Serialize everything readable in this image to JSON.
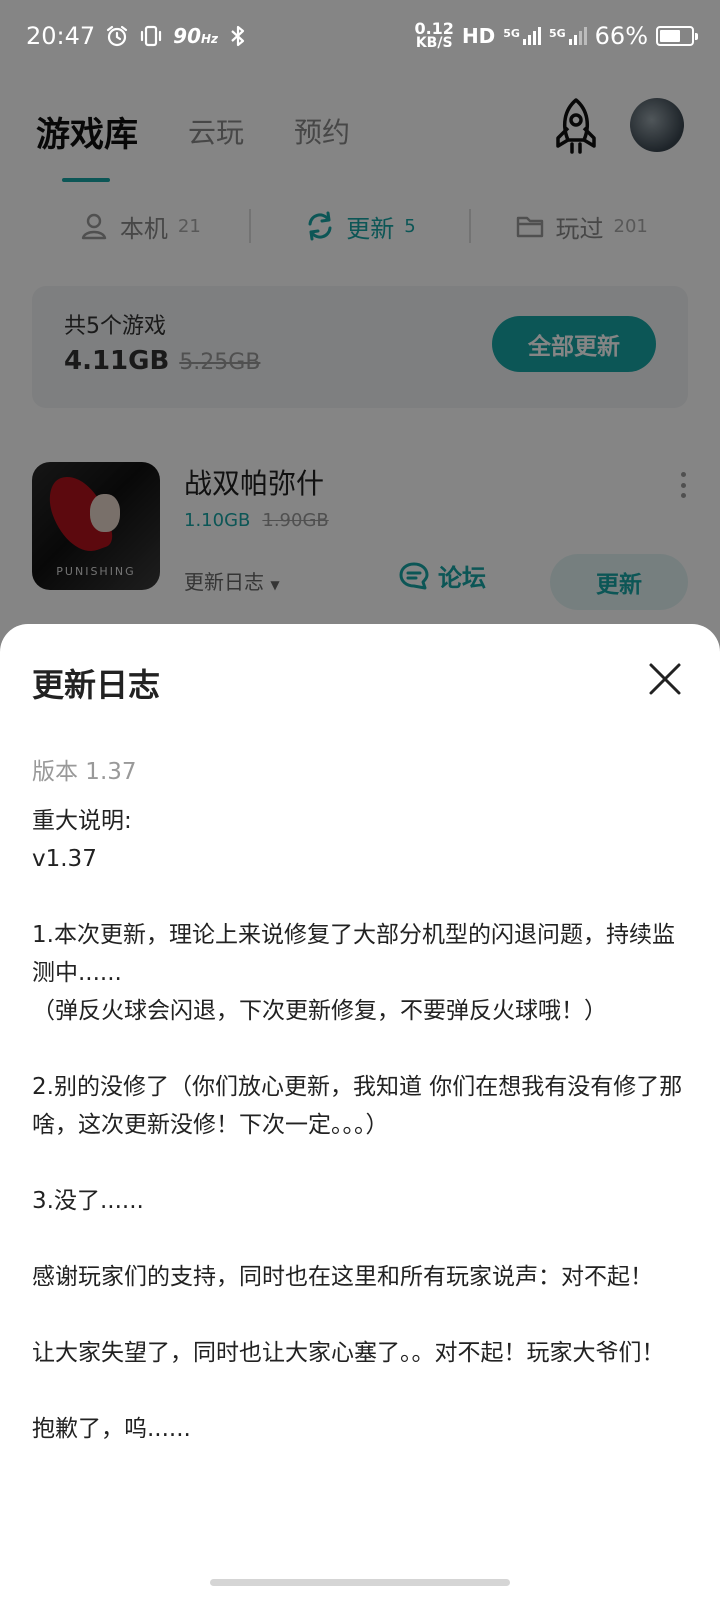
{
  "status_bar": {
    "time": "20:47",
    "refresh_rate": "90",
    "refresh_unit": "Hz",
    "net_speed_value": "0.12",
    "net_speed_unit": "KB/S",
    "hd_label": "HD",
    "network_1": "5G",
    "network_2": "5G",
    "battery": "66%",
    "battery_level": 0.66
  },
  "top_nav": {
    "tabs": [
      {
        "label": "游戏库",
        "active": true
      },
      {
        "label": "云玩",
        "active": false
      },
      {
        "label": "预约",
        "active": false
      }
    ]
  },
  "filters": [
    {
      "label": "本机",
      "count": "21",
      "icon": "phone-user-icon",
      "active": false
    },
    {
      "label": "更新",
      "count": "5",
      "icon": "refresh-icon",
      "active": true
    },
    {
      "label": "玩过",
      "count": "201",
      "icon": "folder-icon",
      "active": false
    }
  ],
  "summary": {
    "label": "共5个游戏",
    "size": "4.11GB",
    "original_size": "5.25GB",
    "update_all_label": "全部更新"
  },
  "game": {
    "title": "战双帕弥什",
    "size": "1.10GB",
    "original_size": "1.90GB",
    "changelog_label": "更新日志",
    "forum_label": "论坛",
    "update_label": "更新",
    "icon_text": "PUNISHING"
  },
  "sheet": {
    "title": "更新日志",
    "version": "版本 1.37",
    "lines": [
      "重大说明:",
      "v1.37",
      "",
      "1.本次更新，理论上来说修复了大部分机型的闪退问题，持续监测中......",
      "（弹反火球会闪退，下次更新修复，不要弹反火球哦！）",
      "",
      "2.别的没修了（你们放心更新，我知道 你们在想我有没有修了那啥，这次更新没修！下次一定。。。）",
      "",
      "3.没了......",
      "",
      "感谢玩家们的支持，同时也在这里和所有玩家说声：对不起！",
      "",
      "让大家失望了，同时也让大家心塞了。。对不起！玩家大爷们！",
      "",
      "抱歉了，呜......"
    ]
  },
  "colors": {
    "accent": "#17a5a5",
    "overlay": "rgba(0,0,0,0.48)"
  }
}
